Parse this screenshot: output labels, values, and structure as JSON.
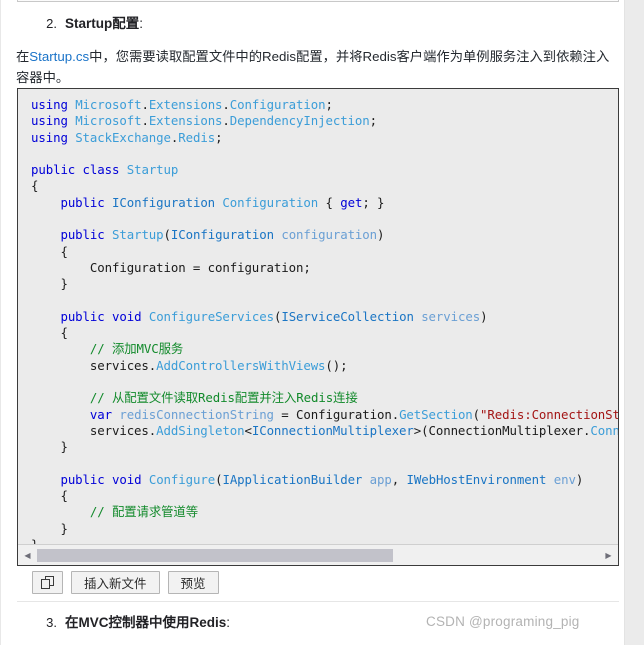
{
  "page": {
    "list_items": [
      {
        "number": "2.",
        "title": "Startup配置",
        "colon": ":"
      },
      {
        "number": "3.",
        "title": "在MVC控制器中使用Redis",
        "colon": ":"
      }
    ],
    "paragraph": {
      "prefix": "在",
      "link": "Startup.cs",
      "rest": "中，您需要读取配置文件中的Redis配置，并将Redis客户端作为单例服务注入到依赖注入容器中。"
    },
    "watermark": "CSDN @programing_pig"
  },
  "code": {
    "language": "csharp",
    "lines": [
      "using Microsoft.Extensions.Configuration;",
      "using Microsoft.Extensions.DependencyInjection;",
      "using StackExchange.Redis;",
      "",
      "public class Startup",
      "{",
      "    public IConfiguration Configuration { get; }",
      "",
      "    public Startup(IConfiguration configuration)",
      "    {",
      "        Configuration = configuration;",
      "    }",
      "",
      "    public void ConfigureServices(IServiceCollection services)",
      "    {",
      "        // 添加MVC服务",
      "        services.AddControllersWithViews();",
      "",
      "        // 从配置文件读取Redis配置并注入Redis连接",
      "        var redisConnectionString = Configuration.GetSection(\"Redis:ConnectionString\").Value;",
      "        services.AddSingleton<IConnectionMultiplexer>(ConnectionMultiplexer.Connect(redisConnectionString));",
      "    }",
      "",
      "    public void Configure(IApplicationBuilder app, IWebHostEnvironment env)",
      "    {",
      "        // 配置请求管道等",
      "    }",
      "}"
    ]
  },
  "toolbar": {
    "copy_label": "",
    "insert_file_label": "插入新文件",
    "preview_label": "预览"
  },
  "scrollbar": {
    "left_arrow": "◀",
    "right_arrow": "▶"
  },
  "colors": {
    "keyword": "#0000d8",
    "type": "#3b9dd8",
    "comment": "#128a2b",
    "string": "#a31515",
    "link": "#1a73c8",
    "code_bg": "#ebebeb"
  }
}
